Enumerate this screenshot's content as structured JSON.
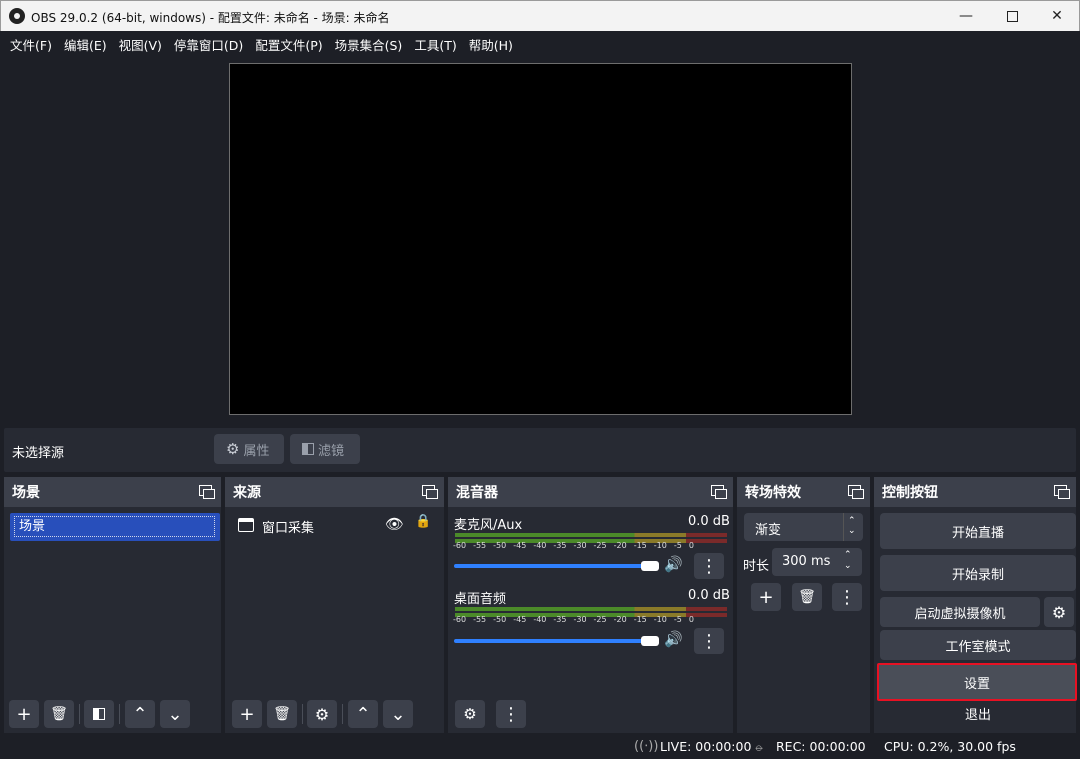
{
  "window": {
    "title": "OBS 29.0.2 (64-bit, windows) - 配置文件: 未命名 - 场景: 未命名"
  },
  "menu": [
    "文件(F)",
    "编辑(E)",
    "视图(V)",
    "停靠窗口(D)",
    "配置文件(P)",
    "场景集合(S)",
    "工具(T)",
    "帮助(H)"
  ],
  "context_bar": {
    "no_source": "未选择源",
    "properties": "属性",
    "filters": "滤镜"
  },
  "scenes": {
    "title": "场景",
    "items": [
      "场景"
    ]
  },
  "sources": {
    "title": "来源",
    "items": [
      "窗口采集"
    ]
  },
  "mixer": {
    "title": "混音器",
    "channels": [
      {
        "name": "麦克风/Aux",
        "db": "0.0 dB"
      },
      {
        "name": "桌面音频",
        "db": "0.0 dB"
      }
    ],
    "ticks": [
      "-60",
      "-55",
      "-50",
      "-45",
      "-40",
      "-35",
      "-30",
      "-25",
      "-20",
      "-15",
      "-10",
      "-5",
      "0"
    ]
  },
  "transitions": {
    "title": "转场特效",
    "selected": "渐变",
    "duration_label": "时长",
    "duration": "300 ms"
  },
  "controls": {
    "title": "控制按钮",
    "start_stream": "开始直播",
    "start_record": "开始录制",
    "virtual_cam": "启动虚拟摄像机",
    "studio_mode": "工作室模式",
    "settings": "设置",
    "exit": "退出"
  },
  "status": {
    "live": "LIVE: 00:00:00",
    "rec": "REC: 00:00:00",
    "cpu": "CPU: 0.2%, 30.00 fps"
  },
  "colors": {
    "highlight": "#e81123",
    "accent": "#284fbb"
  }
}
